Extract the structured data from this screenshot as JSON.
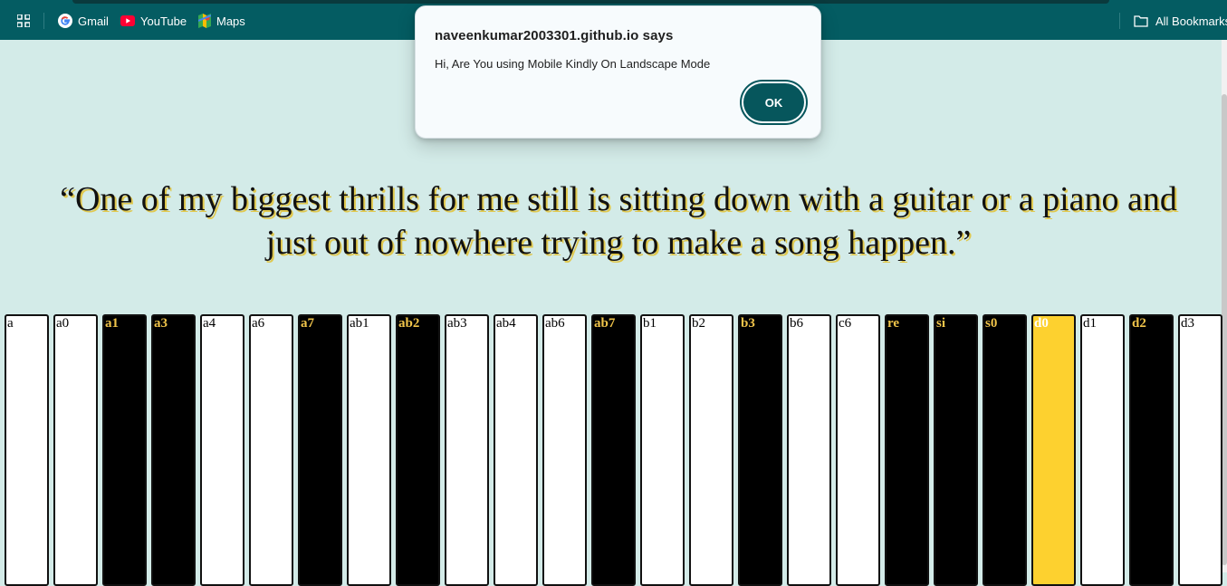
{
  "bookmarks_bar": {
    "items": [
      {
        "label": "Gmail",
        "icon": "google-icon"
      },
      {
        "label": "YouTube",
        "icon": "youtube-icon"
      },
      {
        "label": "Maps",
        "icon": "maps-icon"
      }
    ],
    "all_bookmarks_label": "All Bookmarks"
  },
  "dialog": {
    "title": "naveenkumar2003301.github.io says",
    "message": "Hi, Are You using Mobile Kindly On Landscape Mode",
    "ok_label": "OK"
  },
  "quote": {
    "line1": "“One of my biggest thrills for me still is sitting down with a guitar or a piano and",
    "line2": "just out of nowhere trying to make a song happen.”"
  },
  "piano": {
    "keys": [
      {
        "label": "a",
        "color": "white"
      },
      {
        "label": "a0",
        "color": "white"
      },
      {
        "label": "a1",
        "color": "black"
      },
      {
        "label": "a3",
        "color": "black"
      },
      {
        "label": "a4",
        "color": "white"
      },
      {
        "label": "a6",
        "color": "white"
      },
      {
        "label": "a7",
        "color": "black"
      },
      {
        "label": "ab1",
        "color": "white"
      },
      {
        "label": "ab2",
        "color": "black"
      },
      {
        "label": "ab3",
        "color": "white"
      },
      {
        "label": "ab4",
        "color": "white"
      },
      {
        "label": "ab6",
        "color": "white"
      },
      {
        "label": "ab7",
        "color": "black"
      },
      {
        "label": "b1",
        "color": "white"
      },
      {
        "label": "b2",
        "color": "white"
      },
      {
        "label": "b3",
        "color": "black"
      },
      {
        "label": "b6",
        "color": "white"
      },
      {
        "label": "c6",
        "color": "white"
      },
      {
        "label": "re",
        "color": "black"
      },
      {
        "label": "si",
        "color": "black"
      },
      {
        "label": "s0",
        "color": "black"
      },
      {
        "label": "d0",
        "color": "active"
      },
      {
        "label": "d1",
        "color": "white"
      },
      {
        "label": "d2",
        "color": "black"
      },
      {
        "label": "d3",
        "color": "white"
      }
    ]
  },
  "colors": {
    "toolbar": "#045c62",
    "page_background": "#d3ebe8",
    "black_key_label": "#f0c44a",
    "active_key": "#fdd12f",
    "ok_button": "#06565c"
  }
}
